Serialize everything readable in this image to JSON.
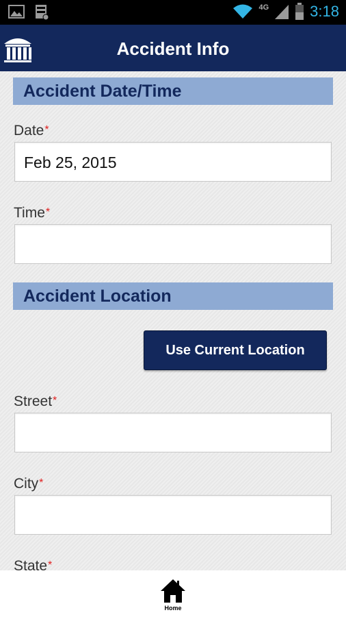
{
  "status_bar": {
    "time": "3:18",
    "network": "4G",
    "icons": [
      "image-icon",
      "storage-icon",
      "wifi-icon",
      "signal-icon",
      "battery-icon"
    ]
  },
  "header": {
    "title": "Accident Info",
    "logo": "building-columns-icon",
    "color": "#13285c"
  },
  "sections": {
    "datetime": {
      "title": "Accident Date/Time",
      "date_label": "Date",
      "date_value": "Feb 25, 2015",
      "time_label": "Time",
      "time_value": ""
    },
    "location": {
      "title": "Accident Location",
      "use_location_label": "Use Current Location",
      "street_label": "Street",
      "street_value": "",
      "city_label": "City",
      "city_value": "",
      "state_label": "State"
    }
  },
  "required_marker": "*",
  "bottom_nav": {
    "home_label": "Home",
    "home_icon": "home-icon"
  },
  "colors": {
    "section_bg": "#8eaad3",
    "required": "#e02020"
  }
}
